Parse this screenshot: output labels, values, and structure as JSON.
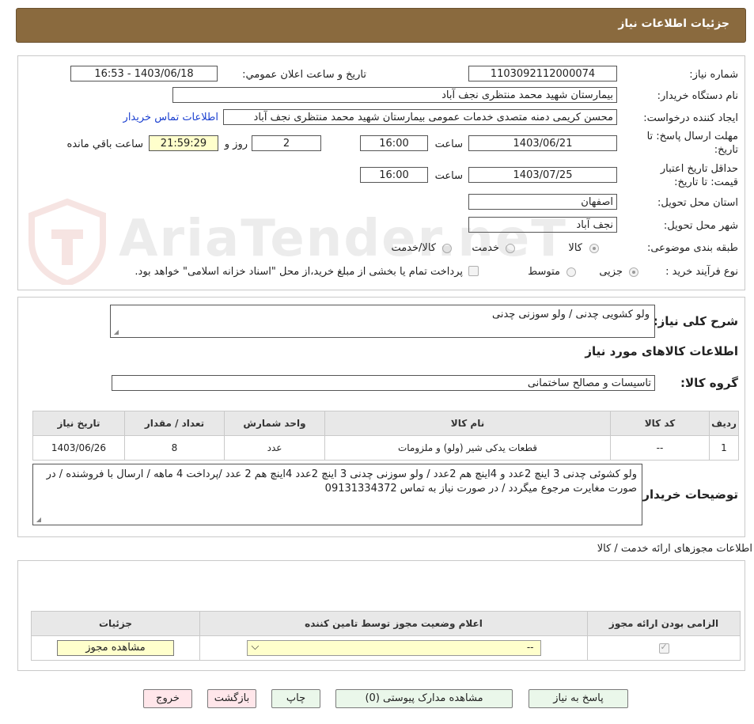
{
  "header": {
    "title": "جزئیات اطلاعات نیاز"
  },
  "form": {
    "need_number_label": "شماره نیاز:",
    "need_number": "1103092112000074",
    "announce_label": "تاریخ و ساعت اعلان عمومي:",
    "announce_value": "1403/06/18 - 16:53",
    "buyer_org_label": "نام دستگاه خريدار:",
    "buyer_org": "بیمارستان شهید محمد منتظری نجف آباد",
    "creator_label": "ايجاد کننده درخواست:",
    "creator": "محسن کریمی دمنه متصدی خدمات عمومی بیمارستان شهید محمد منتظری نجف آباد",
    "contact_link": "اطلاعات تماس خريدار",
    "deadline_label_1": "مهلت ارسال پاسخ: تا",
    "deadline_label_2": "تاریخ:",
    "deadline_date": "1403/06/21",
    "time_label": "ساعت",
    "deadline_time": "16:00",
    "days": "2",
    "days_label": "روز و",
    "remaining_time": "21:59:29",
    "remaining_label": "ساعت باقي مانده",
    "validity_label_1": "حداقل تاريخ اعتبار",
    "validity_label_2": "قيمت: تا تاريخ:",
    "validity_date": "1403/07/25",
    "validity_time": "16:00",
    "province_label": "استان محل تحويل:",
    "province": "اصفهان",
    "city_label": "شهر محل تحويل:",
    "city": "نجف آباد",
    "category_label": "طبقه بندی موضوعی:",
    "category_options": [
      "کالا",
      "خدمت",
      "کالا/خدمت"
    ],
    "category_selected": "کالا",
    "process_label": "نوع فرآیند خرید :",
    "process_options": [
      "جزیی",
      "متوسط"
    ],
    "process_selected": "جزیی",
    "payment_note": "پرداخت تمام یا بخشی از مبلغ خرید،از محل \"اسناد خزانه اسلامی\" خواهد بود."
  },
  "details": {
    "summary_label": "شرح کلی نیاز:",
    "summary": "ولو کشویی چدنی / ولو سوزنی چدنی",
    "goods_info_title": "اطلاعات کالاهای مورد نیاز",
    "group_label": "گروه کالا:",
    "group": "تاسیسات و مصالح ساختمانی",
    "table": {
      "headers": [
        "ردیف",
        "کد کالا",
        "نام کالا",
        "واحد شمارش",
        "تعداد / مقدار",
        "تاریخ نیاز"
      ],
      "rows": [
        [
          "1",
          "--",
          "قطعات یدکی شیر (ولو) و ملزومات",
          "عدد",
          "8",
          "1403/06/26"
        ]
      ]
    },
    "buyer_notes_label": "توضیحات خریدار:",
    "buyer_notes": "ولو کشوئی چدنی 3 اینچ 2عدد و 4اینچ هم  2عدد / ولو سوزنی چدنی 3 اینچ 2عدد 4اینچ هم 2 عدد /پرداخت 4 ماهه / ارسال با فروشنده / در صورت مغایرت مرجوع میگردد / در صورت نیاز به تماس 09131334372"
  },
  "permits": {
    "title": "اطلاعات مجوزهای ارائه خدمت / کالا",
    "headers": [
      "الزامی بودن ارائه مجوز",
      "اعلام وضعیت مجوز توسط تامین کننده",
      "جزئیات"
    ],
    "select_value": "--",
    "view_button": "مشاهده مجوز"
  },
  "buttons": {
    "reply": "پاسخ به نیاز",
    "attachments": "مشاهده مدارک پیوستی (0)",
    "print": "چاپ",
    "back": "بازگشت",
    "exit": "خروج"
  },
  "watermark": {
    "text": "AriaTender.neT"
  },
  "colors": {
    "header_bg": "#8a6a3e",
    "remaining_bg": "#ffffcc",
    "link": "#1a3fd0",
    "btn_green": "#eaf7ea",
    "btn_pink": "#ffe6ea"
  }
}
